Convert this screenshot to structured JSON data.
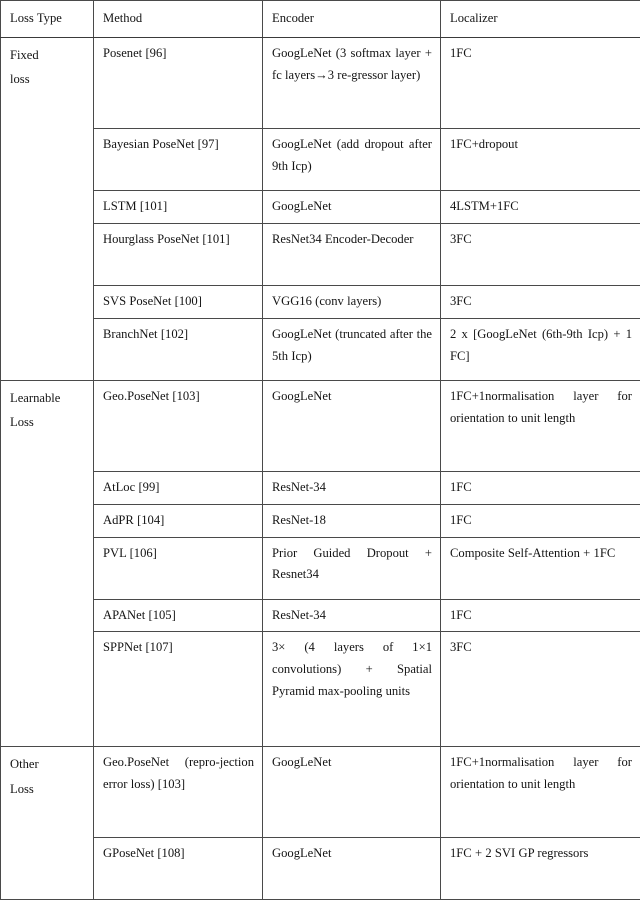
{
  "table": {
    "columns": [
      {
        "key": "loss_type",
        "label": "Loss Type"
      },
      {
        "key": "method",
        "label": "Method"
      },
      {
        "key": "encoder",
        "label": "Encoder"
      },
      {
        "key": "localizer",
        "label": "Localizer"
      }
    ],
    "sections": [
      {
        "loss_type": "Fixed\nloss",
        "loss_type_lines": [
          "Fixed",
          "loss"
        ],
        "rows": [
          {
            "method": "Posenet [96]",
            "encoder": "GoogLeNet (3 softmax layer + fc layers→3 re-gressor layer)",
            "localizer": "1FC"
          },
          {
            "method": "Bayesian PoseNet [97]",
            "encoder": "GoogLeNet (add dropout after 9th Icp)",
            "localizer": "1FC+dropout"
          },
          {
            "method": "LSTM [101]",
            "encoder": "GoogLeNet",
            "localizer": "4LSTM+1FC"
          },
          {
            "method": "Hourglass PoseNet [101]",
            "encoder": "ResNet34 Encoder-Decoder",
            "localizer": "3FC"
          },
          {
            "method": "SVS PoseNet [100]",
            "encoder": "VGG16 (conv layers)",
            "localizer": "3FC"
          },
          {
            "method": "BranchNet [102]",
            "encoder": "GoogLeNet (truncated after the 5th Icp)",
            "localizer": "2 x [GoogLeNet (6th-9th Icp) + 1 FC]"
          }
        ]
      },
      {
        "loss_type": "Learnable\nLoss",
        "loss_type_lines": [
          "Learnable",
          "Loss"
        ],
        "rows": [
          {
            "method": "Geo.PoseNet [103]",
            "encoder": "GoogLeNet",
            "localizer": "1FC+1normalisation layer for orientation to unit length"
          },
          {
            "method": "AtLoc [99]",
            "encoder": "ResNet-34",
            "localizer": "1FC"
          },
          {
            "method": "AdPR [104]",
            "encoder": "ResNet-18",
            "localizer": "1FC"
          },
          {
            "method": "PVL [106]",
            "encoder": "Prior Guided Dropout + Resnet34",
            "localizer": "Composite Self-Attention + 1FC"
          },
          {
            "method": "APANet [105]",
            "encoder": "ResNet-34",
            "localizer": "1FC"
          },
          {
            "method": "SPPNet [107]",
            "encoder": "3× (4 layers of 1×1 convolutions) + Spatial Pyramid max-pooling units",
            "localizer": "3FC"
          }
        ]
      },
      {
        "loss_type": "Other\nLoss",
        "loss_type_lines": [
          "Other",
          "Loss"
        ],
        "rows": [
          {
            "method": "Geo.PoseNet (repro-jection error loss) [103]",
            "encoder": "GoogLeNet",
            "localizer": "1FC+1normalisation layer for orientation to unit length"
          },
          {
            "method": "GPoseNet [108]",
            "encoder": "GoogLeNet",
            "localizer": "1FC + 2 SVI GP regressors"
          }
        ]
      }
    ]
  },
  "colors": {
    "border": "#4a4a4a",
    "border_strong": "#3a3a3a",
    "text": "#141414",
    "background": "#ffffff"
  }
}
